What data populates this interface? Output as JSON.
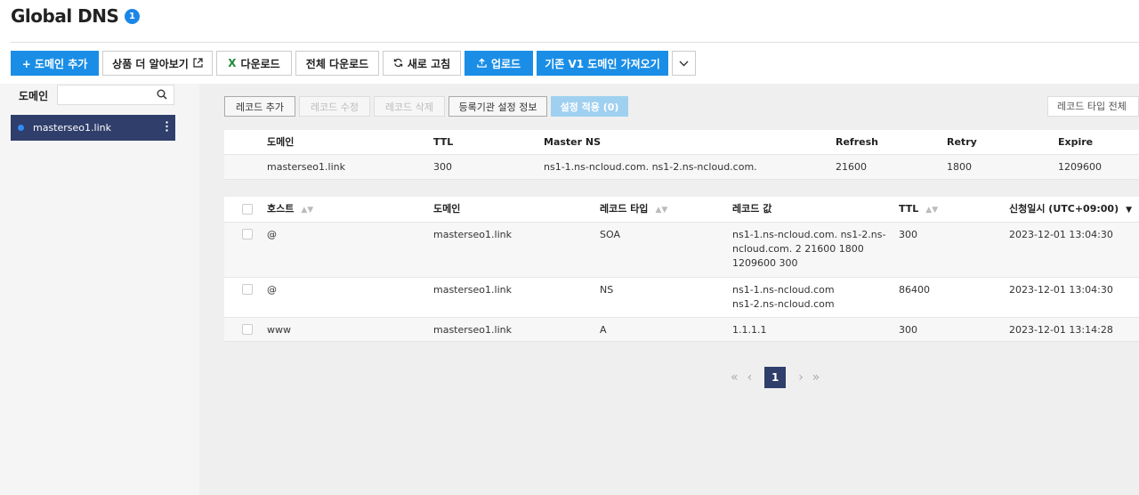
{
  "header": {
    "title": "Global DNS",
    "badge": "1"
  },
  "toolbar": {
    "add_domain": "+ 도메인 추가",
    "learn_more": "상품 더 알아보기",
    "download": "다운로드",
    "download_all": "전체 다운로드",
    "refresh": "새로 고침",
    "upload": "업로드",
    "import_v1": "기존 V1 도메인 가져오기"
  },
  "sidebar": {
    "label": "도메인",
    "search_placeholder": "",
    "domains": [
      {
        "name": "masterseo1.link",
        "selected": true
      }
    ]
  },
  "record_toolbar": {
    "add": "레코드 추가",
    "edit": "레코드 수정",
    "delete": "레코드 삭제",
    "registrar_info": "등록기관 설정 정보",
    "apply": "설정 적용 (0)",
    "type_filter": "레코드 타입 전체"
  },
  "domain_table": {
    "columns": [
      "도메인",
      "TTL",
      "Master NS",
      "Refresh",
      "Retry",
      "Expire"
    ],
    "row": [
      "masterseo1.link",
      "300",
      "ns1-1.ns-ncloud.com. ns1-2.ns-ncloud.com.",
      "21600",
      "1800",
      "1209600"
    ]
  },
  "record_table": {
    "columns": [
      "호스트",
      "도메인",
      "레코드 타입",
      "레코드 값",
      "TTL",
      "신청일시 (UTC+09:00)"
    ],
    "rows": [
      {
        "host": "@",
        "domain": "masterseo1.link",
        "type": "SOA",
        "value_lines": [
          "ns1-1.ns-ncloud.com. ns1-2.ns-",
          "ncloud.com. 2 21600 1800",
          "1209600 300"
        ],
        "ttl": "300",
        "date": "2023-12-01 13:04:30"
      },
      {
        "host": "@",
        "domain": "masterseo1.link",
        "type": "NS",
        "value_lines": [
          "ns1-1.ns-ncloud.com",
          "ns1-2.ns-ncloud.com"
        ],
        "ttl": "86400",
        "date": "2023-12-01 13:04:30"
      },
      {
        "host": "www",
        "domain": "masterseo1.link",
        "type": "A",
        "value_lines": [
          "1.1.1.1"
        ],
        "ttl": "300",
        "date": "2023-12-01 13:14:28"
      }
    ]
  },
  "pagination": {
    "current": "1"
  },
  "colors": {
    "primary": "#1a8ee6",
    "navy": "#2f3e6b",
    "badge": "#1a87e8"
  }
}
